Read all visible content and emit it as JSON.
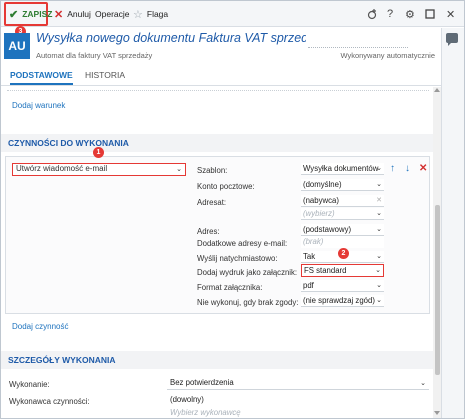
{
  "toolbar": {
    "save_label": "ZAPISZ",
    "cancel_label": "Anuluj",
    "operations_label": "Operacje",
    "flag_label": "Flaga"
  },
  "header": {
    "avatar_text": "AU",
    "title": "Wysyłka nowego dokumentu Faktura VAT sprzedaż",
    "subtitle": "Automat dla faktury VAT sprzedaży",
    "mode_label": "Wykonywany automatycznie"
  },
  "tabs": [
    {
      "label": "PODSTAWOWE",
      "active": true
    },
    {
      "label": "HISTORIA",
      "active": false
    }
  ],
  "conditions": {
    "add_condition_label": "Dodaj warunek"
  },
  "actions_section": {
    "title": "CZYNNOŚCI DO WYKONANIA",
    "action_select_value": "Utwórz wiadomość e-mail",
    "add_action_label": "Dodaj czynność",
    "params": [
      {
        "label": "Szablon:",
        "value": "Wysyłka dokumentów"
      },
      {
        "label": "Konto pocztowe:",
        "value": "(domyślne)"
      },
      {
        "label": "Adresat:",
        "value": "(nabywca)"
      },
      {
        "label": "",
        "value": "(wybierz)"
      },
      {
        "label": "Adres:",
        "value": "(podstawowy)"
      },
      {
        "label": "Dodatkowe adresy e-mail:",
        "value": "(brak)"
      },
      {
        "label": "Wyślij natychmiastowo:",
        "value": "Tak"
      },
      {
        "label": "Dodaj wydruk jako załącznik:",
        "value": "FS standard"
      },
      {
        "label": "Format załącznika:",
        "value": "pdf"
      },
      {
        "label": "Nie wykonuj, gdy brak zgody:",
        "value": "(nie sprawdzaj zgód)"
      }
    ]
  },
  "details_section": {
    "title": "SZCZEGÓŁY WYKONANIA",
    "rows": [
      {
        "label": "Wykonanie:",
        "value": "Bez potwierdzenia"
      },
      {
        "label": "Wykonawca czynności:",
        "value": "(dowolny)"
      },
      {
        "label": "",
        "value": "Wybierz wykonawcę"
      }
    ]
  },
  "badges": [
    "1",
    "2",
    "3"
  ],
  "icons": {
    "save": "check-icon",
    "cancel": "close-icon",
    "flag": "star-icon",
    "right": [
      "add-watch-icon",
      "help-icon",
      "settings-icon",
      "maximize-icon",
      "close-window-icon"
    ]
  },
  "colors": {
    "accent": "#1e73be",
    "highlight": "#e53935",
    "save_green": "#2e7d32"
  }
}
